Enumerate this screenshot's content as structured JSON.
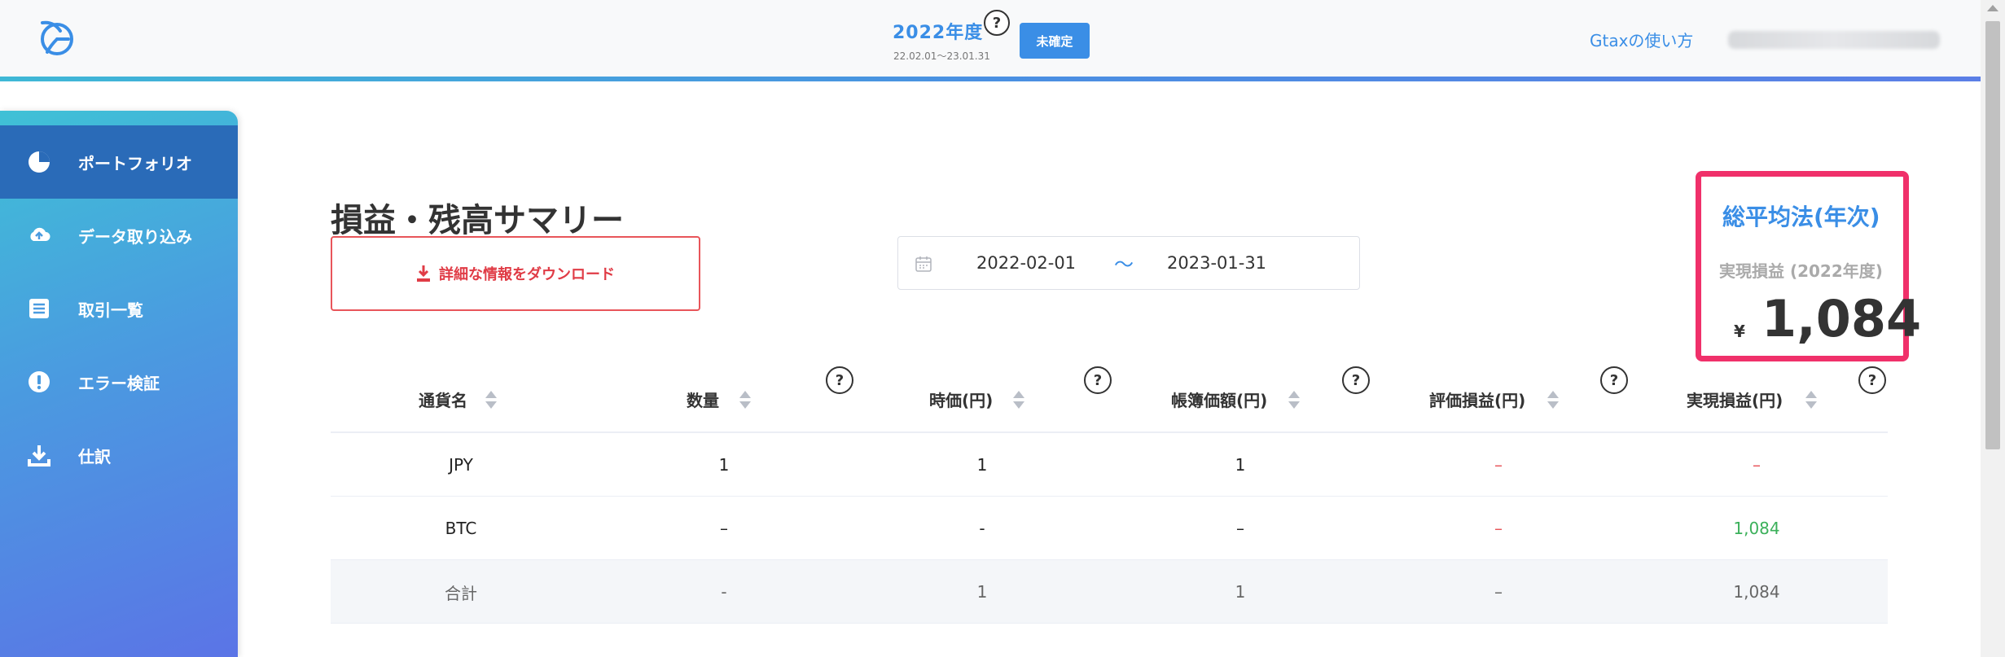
{
  "header": {
    "fiscal_year": "2022年度",
    "fiscal_range": "22.02.01〜23.01.31",
    "status_badge": "未確定",
    "help_icon": "?",
    "howto_link": "Gtaxの使い方",
    "user_email": ""
  },
  "sidebar": {
    "items": [
      {
        "label": "ポートフォリオ",
        "icon": "pie-chart-icon"
      },
      {
        "label": "データ取り込み",
        "icon": "cloud-upload-icon"
      },
      {
        "label": "取引一覧",
        "icon": "list-icon"
      },
      {
        "label": "エラー検証",
        "icon": "alert-icon"
      },
      {
        "label": "仕訳",
        "icon": "download-icon"
      }
    ]
  },
  "main": {
    "title": "損益・残高サマリー",
    "download_label": "詳細な情報をダウンロード",
    "date_start": "2022-02-01",
    "date_separator": "〜",
    "date_end": "2023-01-31"
  },
  "method": {
    "title": "総平均法(年次)",
    "sub": "実現損益 (2022年度)",
    "currency": "¥",
    "value": "1,084"
  },
  "table": {
    "help": "?",
    "headers": [
      "通貨名",
      "数量",
      "時価(円)",
      "帳簿価額(円)",
      "評価損益(円)",
      "実現損益(円)"
    ],
    "rows": [
      [
        "JPY",
        "1",
        "1",
        "1",
        "–",
        "–"
      ],
      [
        "BTC",
        "–",
        "-",
        "–",
        "–",
        "1,084"
      ],
      [
        "合計",
        "-",
        "1",
        "1",
        "–",
        "1,084"
      ]
    ]
  },
  "colors": {
    "accent": "#3a8ee6",
    "highlight_border": "#f0306a",
    "download_red": "#e03c46",
    "positive_green": "#3bb05a"
  }
}
